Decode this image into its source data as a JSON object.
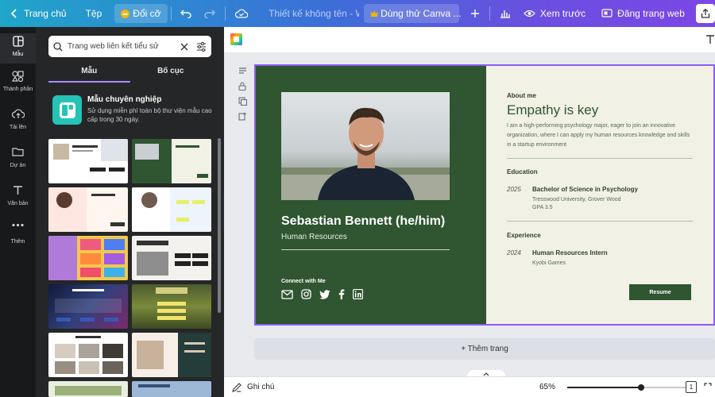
{
  "topbar": {
    "home": "Trang chủ",
    "file": "Tệp",
    "resize": "Đổi cỡ",
    "doc_title": "Thiết kế không tên - Webs...",
    "trial": "Dùng thử Canva ...",
    "preview": "Xem trước",
    "publish": "Đăng trang web"
  },
  "rail": [
    {
      "label": "Mẫu"
    },
    {
      "label": "Thành phần"
    },
    {
      "label": "Tải lên"
    },
    {
      "label": "Dự án"
    },
    {
      "label": "Văn bản"
    },
    {
      "label": "Thêm"
    }
  ],
  "panel": {
    "search_value": "Trang web liên kết tiểu sử",
    "tab_templates": "Mẫu",
    "tab_layouts": "Bố cục",
    "promo_title": "Mẫu chuyên nghiệp",
    "promo_desc": "Sử dụng miễn phí toàn bộ thư viện mẫu cao cấp trong 30 ngày."
  },
  "page": {
    "name": "Sebastian Bennett (he/him)",
    "role": "Human Resources",
    "connect": "Connect with Me",
    "about_label": "About me",
    "headline": "Empathy is key",
    "about_text": "I am a high-performing psychology major, eager to join an innovative organization, where I can apply my human resources knowledge and skills in a startup environment",
    "education_label": "Education",
    "edu_year": "2025",
    "edu_degree": "Bachelor of Science in Psychology",
    "edu_school": "Tresswood University, Grover Wood",
    "edu_gpa": "GPA 3.5",
    "experience_label": "Experience",
    "exp_year": "2024",
    "exp_title": "Human Resources Intern",
    "exp_company": "Kyobi Games",
    "resume_button": "Resume"
  },
  "canvas": {
    "add_page": "+ Thêm trang"
  },
  "bottombar": {
    "notes": "Ghi chú",
    "zoom": "65%",
    "zoom_level": 0.62,
    "page_count": "1"
  },
  "colors": {
    "brand_green": "#2f5531",
    "accent_purple": "#8b5cf6",
    "cream": "#f1f1e6"
  }
}
